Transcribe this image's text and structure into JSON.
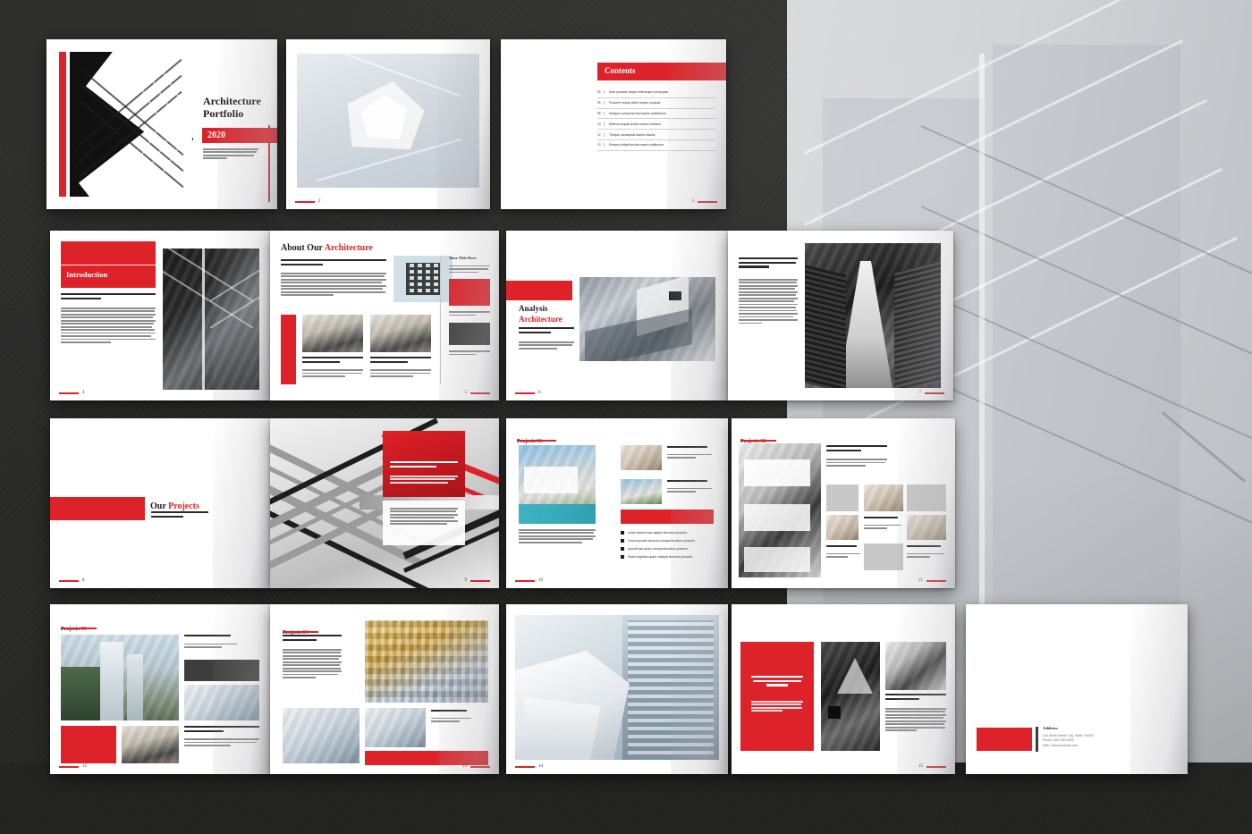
{
  "meta": {
    "doc_title": "Architecture Portfolio",
    "accent_red": "#dd2229",
    "dark": "#232322",
    "sheet_bg": "#ffffff"
  },
  "cover": {
    "title_line1": "Architecture",
    "title_line2": "Portfolio",
    "year": "2020",
    "subtitle": "Lorem ipsumi siamet sedsu quam volutpat efficitur nan tincidunt quisante."
  },
  "page2": {
    "number": "2",
    "caption": ""
  },
  "contents": {
    "number": "3",
    "heading": "Contents",
    "items": [
      {
        "num": "04",
        "text": "Duis posuere neque  elifeneque consequat."
      },
      {
        "num": "06",
        "text": "Posuere neque  elifnd neque conquat."
      },
      {
        "num": "08",
        "text": "Nneque consat lacinia mauris vestibulum."
      },
      {
        "num": "10",
        "text": "Elifend nequat lacinia mauris vestibul."
      },
      {
        "num": "12",
        "text": "Tneque consequat lacinia mauris ."
      },
      {
        "num": "14",
        "text": "Rneque elifeat lacinia mauris estibulum."
      }
    ]
  },
  "page4": {
    "number": "4",
    "heading": "Introduction",
    "lead": "Lorem ipsumi siamet sedsu quam volutpat efficitur non tincidunt quisante.",
    "body": "Consectetur adipiscing elit. Sed arcu quam, volutpat id efficitur non, tincidunt quis ante. Etiam vitae sem suscipit, tincidunt ligula vel, rhoncus dolor. Donec commodo ante orci, sed pellentesque ligula lacinia ac. Fusce vestibulum mauris lacus, in porta velit sollicitudin sed. Aliquam erat volutpat. Maecenas egestas, dui eu mattis ornare, felis diam luctus arcu, vel iaculis velit lorem vel enim. Duis posuere neque sed neque consequat, ex lacinia mauris vestibulum. Nam turpis condimentum, iaculis ipsum."
  },
  "page5": {
    "number": "5",
    "heading_black": "About Our ",
    "heading_red": "Architecture",
    "lead": "Lorem ipsumi siamet sedsu quam volutpat efficitur non tincidunt quisante.",
    "body": "Consectetur sed pellentesque ligula lacinia ac. Fusce vestibulum mauris lacus, in porta velit sollicitudin sed. Aliquam erat volutpat. Maecenas egestas, dui eu mattis ornare, felis diam luctus arcu, vel iaculis velit lorem vel enim. Duis posuere neque sed neque consequat, ex lacinia mauris vestibulum turpis condimentum, iaculis ipsum.",
    "cards": [
      {
        "title": "Lorem ipsumi siau quam volutpat tincidunt quisante.",
        "body": "Consectetur sed pellentesque ligula nes egestas, dui mattis ornar felis diam neque consequat."
      },
      {
        "title": "Lorem ipsumi siau quam volutpat tincidunt quisante.",
        "body": "Consectetur sed pellentesque ligula nes egestas, dui mattis ornar felis diam neque consequat."
      }
    ],
    "sidebar": {
      "title": "Your Title Here",
      "intro": "Consectet pellentesqur mattis ornar felis diam neque consequat.",
      "caption1": "Mattis ornar felis diam neque consequat.",
      "caption2": "Mattis ornar felis diam neque consequat."
    }
  },
  "page6": {
    "number": "6",
    "heading_black": "Analysis",
    "heading_red": "Architecture",
    "lead": "Lorem ipsumi siau quam volutpat tincidunt quisante.",
    "body": "Consectetur sed pellentesque ligula nes egestas, dui mattis ornar felis diam neque consequat."
  },
  "page7": {
    "number": "7",
    "lead": "Lorem ipsumi siamet sedsu quam volutpat efficitur non tincidunt quisante.",
    "body": "Consectetur adipiscing elit. Sed arcu quam, volutpat id efficitur non, tincidunt quis ante. Etiam vitae sem suscipit, tincidunt ligula vel, rhoncus dolor. Donec commodo ante orci, sed pellentesque ligula lacinia ac. Fusce vestibulum mauris lacus, in porta velit sollici tudin sed. Aliquam erat volutpat. Maecenas egestas, dui eu mattis ornare, felis diam luctus arcu, vel iaculis velit lorem vel enim. Duis posuere neque sed neque consequat, eu lacinia mauris vestibulum. Nam turpis condimentum, iaculis ipsum."
  },
  "page8": {
    "number": "8",
    "heading_black": "Our ",
    "heading_red": "Projects",
    "lead": "Lorem ipsumi siau quam volutpat tincidunt quisante."
  },
  "page9": {
    "number": "9",
    "overlay_title": "LOREM IPSUMLA QU VOLUTPAT TINCUNT QUISANTE.",
    "overlay_body": "Consectetur sed pellentesque ligula nes egestas, dui mattis ornar felis diam neque consequat.",
    "panel_body": "consectetur adipiscing elitred arcu quam, volutpat idekl efficitur tudin sed, Aliquam erat volutpat. Maece nas egestas, dui eut mattis ornare neque sedneque conquat lacinia mauris vestibulugra condimentam iaculis ipsum."
  },
  "page10": {
    "number": "10",
    "heading_black": "Projects ",
    "heading_red": "01",
    "main_caption": "onsectetur adipiscing elitred arcu quam, volut pat rbkl efficitur tudin sed, Aliquam erat volut pat. Maece nos egestas, dui euti mattis ornare neque sedneque conquat lacinia mauris vestib ulurpis condimentam iaculis ipsum.",
    "thumbs": [
      {
        "title": "Ipsumli ticid quiante.",
        "body": "Consete septell nteeq lqque consquat."
      },
      {
        "title": "Ipsumli ticid quiante.",
        "body": "Consete septell nteeq lqque consquat."
      }
    ],
    "bullets": [
      "Lorem ipsumli siau qlqtpat tincidunt quisante.",
      "Dorem ipsumli sleusom volutpat tincidunt quisante.",
      "Ipsumli siau quam volutpat tincidunt quisante.",
      "Psumli sightrau quam volutpat tincidunt quisante."
    ]
  },
  "page11": {
    "number": "11",
    "heading_black": "Projects ",
    "heading_red": "02",
    "lead": "Lorem ipsumli siau quam volutpat tincidunt quisante.",
    "body": "Consectetur sed pellentesque ligula nes egestas, dui mattis ornar felis diam neque consequat.",
    "cells": [
      {
        "title": "Ipsumli ticid quiante.",
        "body": "Consete septell nteeq lqque consquat."
      },
      {
        "title": "Ipsumli ticid quiante.",
        "body": "Consete septell nteeq lqque consquat."
      },
      {
        "title": "Ipsumli ticid quiante.",
        "body": "Consete septell nteeq lqque consquat."
      }
    ]
  },
  "page12": {
    "number": "12",
    "heading_black": "Projects ",
    "heading_red": "03",
    "side_title": "Ipsumli ticid quiante.",
    "side_body": "Consete septell nteeq lqque consquat.",
    "bottom_title": "Lorem ipsumli siau quam volutpat tincidunt quisante.",
    "bottom_body": "Consectetur sed pellentesque ligula nes egestas, dui mattis ornar felis diam neque consequat."
  },
  "page13": {
    "number": "13",
    "heading_black": "Projects ",
    "heading_red": "04",
    "lead": "Lorem ipsumli siau quam volutpat tincidunt quisante.",
    "body": "Consectetur sed pellentesque ligula nes egestas, dui mattis ornar felis diam neque consequat. onsectetur adipiscing elitred arcu quam, volut pat idrkl efficitur tudin sed. Aliquam erat volut pat. Maece nas egestas, dui autr mattis ornare neque sedneque conquat lacinia mauris vestib ulurpis condimentam iaculis ipsum.",
    "caption_title": "Ipsumli ticid quiante.",
    "caption_body": "Consete septell nteeq lqque consquat."
  },
  "page14": {
    "number": "14"
  },
  "page15": {
    "number": "15",
    "panel_title": "LOREM IPSUMLR QU VOLUTPAT TINCUNT QUI SANTE.",
    "panel_body": "Consectetur sed pellentesque ligula nes egestas dui mat tis ornar felis diam neque consequat.",
    "lead": "Lorem ipsumli siau quam volutpat tincidunt quisante.",
    "body": "Consectetur sed pellentesque ligula nes egestas, dui mattis ornar felis diam neque consequat. consecte tur adipiscing elitred arcu quam, volut pat idrkl efficitur tudin sed. Aliquam erat volut pat. Maece nas egestas, dui eutr mattis ornare neque sedneque conquat lacinia tum iaculis ipsum."
  },
  "backcover": {
    "address_label": "Address:",
    "street": "123 Street Name City, State, 00000",
    "phone": "Phone: 000-000-0000",
    "web": "Web: www.example.com"
  }
}
